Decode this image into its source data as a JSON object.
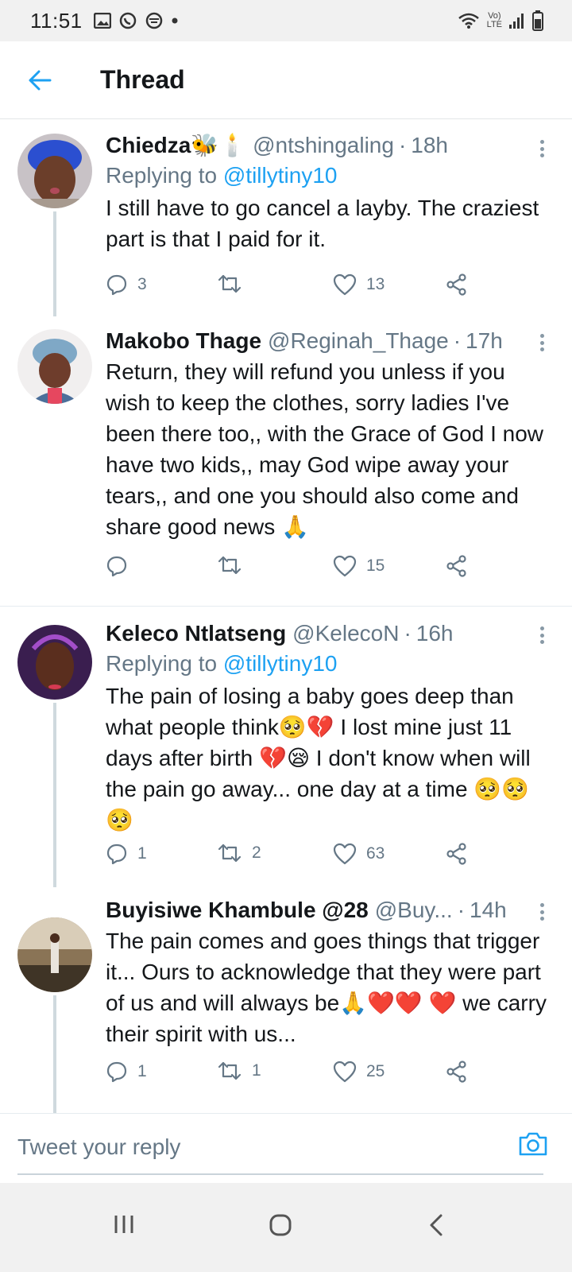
{
  "status_bar": {
    "time": "11:51",
    "network_label_top": "Vo)",
    "network_label_bottom": "LTE"
  },
  "header": {
    "title": "Thread"
  },
  "tweets": [
    {
      "name": "Chiedza🐝🕯️",
      "handle": "@ntshingaling",
      "time": "18h",
      "replying_prefix": "Replying to",
      "replying_to": "@tillytiny10",
      "text": "I still have to go cancel a layby. The craziest part is that I paid for it.",
      "replies": "3",
      "retweets": "",
      "likes": "13"
    },
    {
      "name": "Makobo Thage",
      "handle": "@Reginah_Thage",
      "time": "17h",
      "text": "Return, they will refund you unless if you wish to keep the clothes, sorry ladies I've been there too,, with the Grace of God I now have two kids,, may God wipe away your tears,, and one you should also come and share good news 🙏",
      "replies": "",
      "retweets": "",
      "likes": "15"
    },
    {
      "name": "Keleco Ntlatseng",
      "handle": "@KelecoN",
      "time": "16h",
      "replying_prefix": "Replying to",
      "replying_to": "@tillytiny10",
      "text": "The pain of losing a baby goes deep than what people think🥺💔 I lost mine just 11 days after birth 💔😪 I don't know when will the pain go away... one day at a time 🥺🥺🥺",
      "replies": "1",
      "retweets": "2",
      "likes": "63"
    },
    {
      "name": "Buyisiwe Khambule @28",
      "handle": "@Buy...",
      "time": "14h",
      "text": "The pain comes and goes things that trigger it... Ours to acknowledge that they were part of us and will always be🙏❤️❤️ ❤️ we carry their spirit with us...",
      "replies": "1",
      "retweets": "1",
      "likes": "25"
    }
  ],
  "reply_bar": {
    "placeholder": "Tweet your reply"
  },
  "colors": {
    "accent": "#1da1f2",
    "secondary_text": "#657786",
    "primary_text": "#14171a"
  }
}
